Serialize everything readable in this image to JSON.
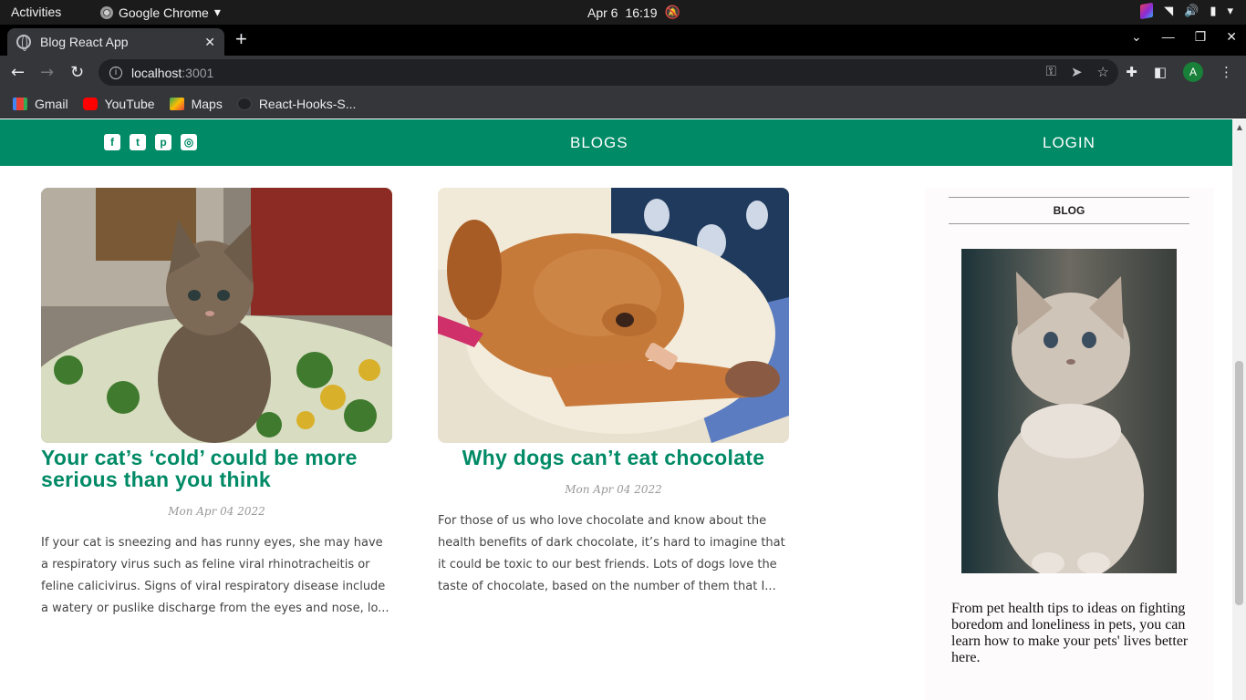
{
  "os_bar": {
    "activities": "Activities",
    "app_name": "Google Chrome",
    "date": "Apr 6",
    "time": "16:19"
  },
  "browser": {
    "tab_title": "Blog React App",
    "url_host": "localhost",
    "url_port": ":3001",
    "avatar_letter": "A",
    "bookmarks": [
      {
        "label": "Gmail",
        "icon": "gmail-icon"
      },
      {
        "label": "YouTube",
        "icon": "youtube-icon"
      },
      {
        "label": "Maps",
        "icon": "maps-icon"
      },
      {
        "label": "React-Hooks-S...",
        "icon": "github-icon"
      }
    ]
  },
  "site": {
    "brand_color": "#008a66",
    "nav": {
      "social": [
        "facebook-icon",
        "twitter-icon",
        "pinterest-icon",
        "instagram-icon"
      ],
      "blogs_label": "BLOGS",
      "login_label": "LOGIN"
    },
    "posts": [
      {
        "title": "Your cat’s ‘cold’ could be more serious than you think",
        "date": "Mon Apr 04 2022",
        "excerpt": "If your cat is sneezing and has runny eyes, she may have a respiratory virus such as feline viral rhinotracheitis or feline calicivirus. Signs of viral respiratory disease include a watery or puslike discharge from the eyes and nose, lo...",
        "image": "kitten-photo"
      },
      {
        "title": "Why dogs can’t eat chocolate",
        "date": "Mon Apr 04 2022",
        "excerpt": "For those of us who love chocolate and know about the health benefits of dark chocolate, it’s hard to imagine that it could be toxic to our best friends. Lots of dogs love the taste of chocolate, based on the number of them that I...",
        "image": "dog-photo"
      }
    ],
    "sidebar": {
      "title": "BLOG",
      "image": "fluffy-kitten-photo",
      "text": "From pet health tips to ideas on fighting boredom and loneliness in pets, you can learn how to make your pets' lives better here."
    }
  }
}
